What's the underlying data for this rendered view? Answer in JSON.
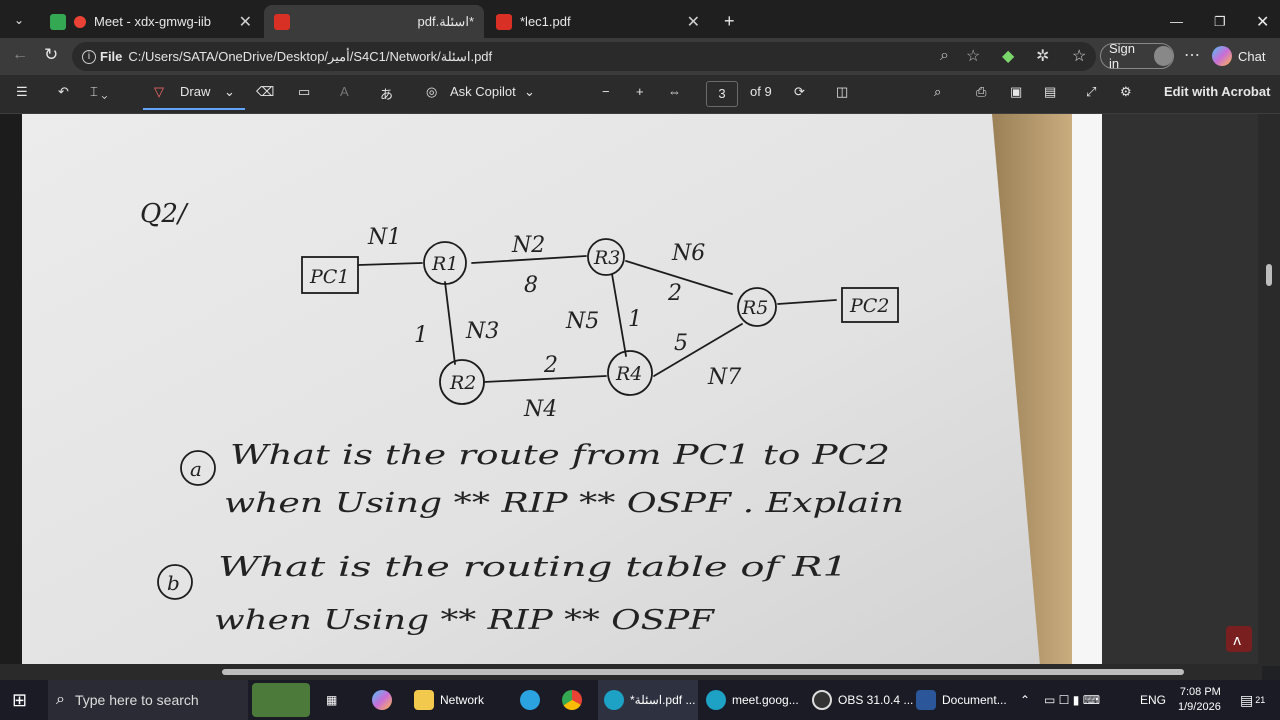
{
  "browser": {
    "tabs": [
      {
        "label": "Meet - xdx-gmwg-iib",
        "active": false
      },
      {
        "label": "pdf.اسئلة*",
        "active": true
      },
      {
        "label": "*lec1.pdf",
        "active": false
      }
    ],
    "address": {
      "scheme": "File",
      "path": "C:/Users/SATA/OneDrive/Desktop/أمير/S4C1/Network/اسئلة.pdf"
    },
    "sign_in": "Sign in",
    "chat": "Chat"
  },
  "toolbar": {
    "draw": "Draw",
    "ask_copilot": "Ask Copilot",
    "page_current": "3",
    "page_total": "of 9",
    "edit_acrobat": "Edit with Acrobat"
  },
  "document": {
    "question_label": "Q2/",
    "nodes": [
      "PC1",
      "R1",
      "R3",
      "R5",
      "PC2",
      "R2",
      "R4"
    ],
    "networks": [
      "N1",
      "N2",
      "N3",
      "N4",
      "N5",
      "N6",
      "N7"
    ],
    "costs": [
      "8",
      "1",
      "2",
      "1",
      "2",
      "5"
    ],
    "questions": [
      {
        "marker": "a",
        "line1": "What is the route from PC1 to PC2",
        "line2": "when Using ** RIP ** OSPF . Explain"
      },
      {
        "marker": "b",
        "line1": "What is the routing table of R1",
        "line2": "when Using ** RIP ** OSPF"
      }
    ]
  },
  "taskbar": {
    "search_placeholder": "Type here to search",
    "apps": [
      "Network",
      "*اسئلة.pdf ...",
      "meet.goog...",
      "OBS 31.0.4 ...",
      "Document..."
    ],
    "lang": "ENG",
    "time": "7:08 PM",
    "date": "1/9/2026",
    "notifications": "21"
  },
  "colors": {
    "accent": "#60a5fa",
    "pdf_red": "#c0392b"
  }
}
